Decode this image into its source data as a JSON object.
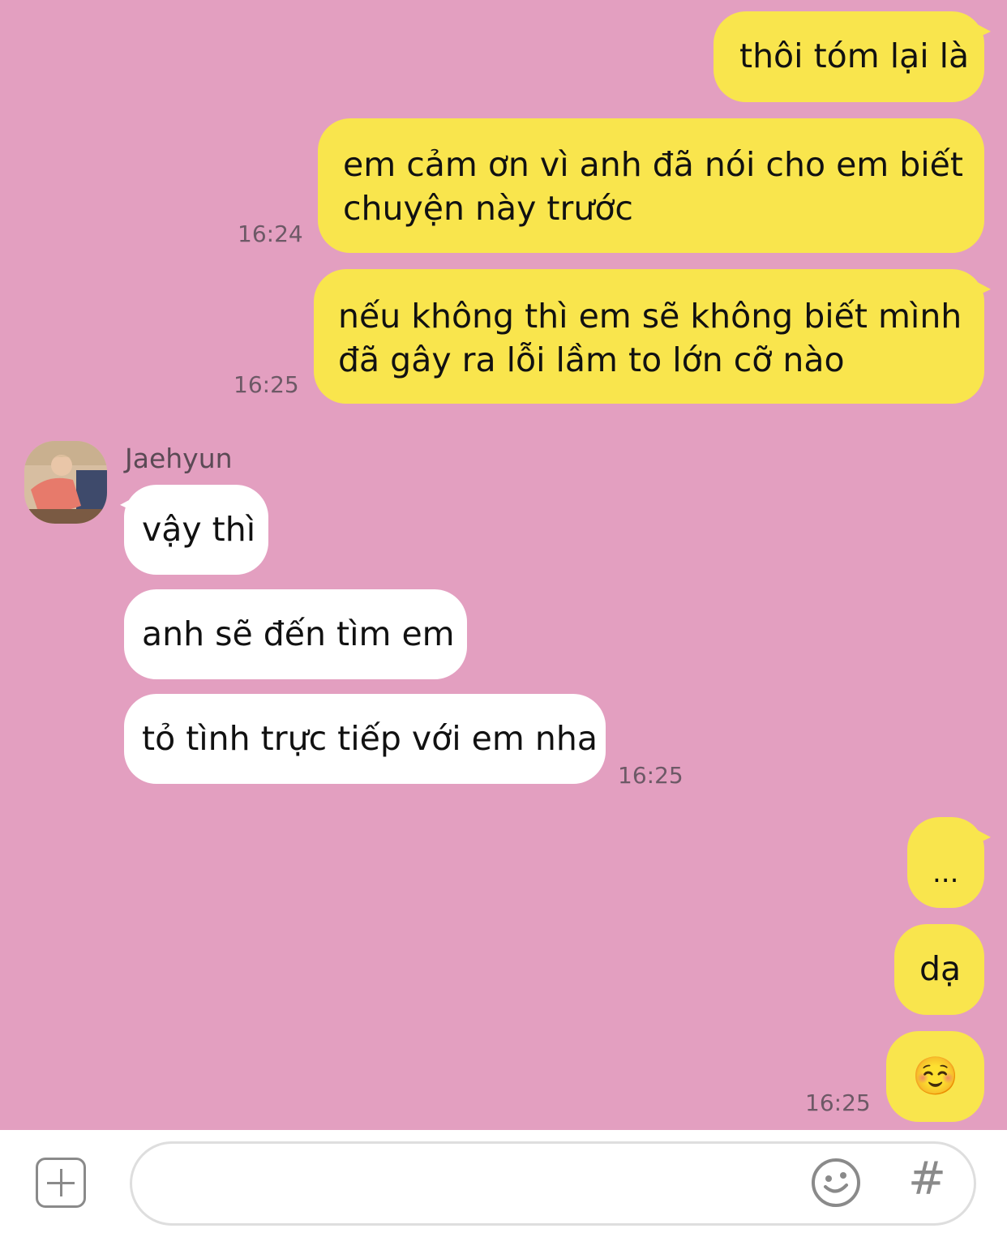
{
  "colors": {
    "chat_background": "#e39fc0",
    "outgoing_bubble": "#f9e54d",
    "incoming_bubble": "#ffffff",
    "timestamp_text": "#6d5966"
  },
  "messages": {
    "m1": {
      "text": "thôi tóm lại là"
    },
    "m2": {
      "line1": "em cảm ơn vì anh đã nói cho em biết",
      "line2": "chuyện này trước",
      "time": "16:24"
    },
    "m3": {
      "line1": "nếu không thì em sẽ không biết mình",
      "line2": "đã gây ra lỗi lầm to lớn cỡ nào",
      "time": "16:25"
    },
    "sender_name": "Jaehyun",
    "m4": {
      "text": "vậy thì"
    },
    "m5": {
      "text": "anh sẽ đến tìm em"
    },
    "m6": {
      "text": "tỏ tình trực tiếp với em nha",
      "time": "16:25"
    },
    "m7": {
      "text": "..."
    },
    "m8": {
      "text": "dạ"
    },
    "m9": {
      "text": "☺️",
      "time": "16:25"
    }
  },
  "input_bar": {
    "attach_icon": "plus-square-icon",
    "message_value": "",
    "emoji_icon": "smiley-icon",
    "hashtag_label": "#"
  }
}
